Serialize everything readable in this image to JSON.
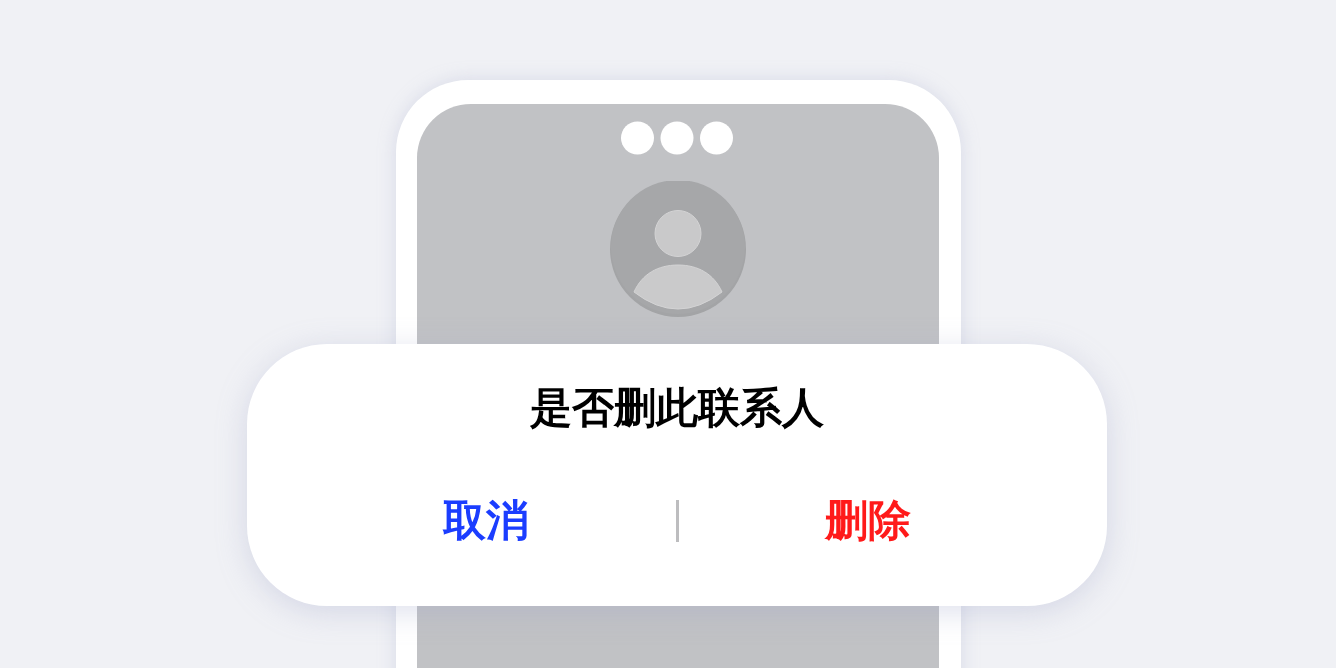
{
  "dialog": {
    "title": "是否删此联系人",
    "buttons": [
      {
        "label": "取消",
        "kind": "cancel"
      },
      {
        "label": "删除",
        "kind": "destructive"
      }
    ]
  }
}
